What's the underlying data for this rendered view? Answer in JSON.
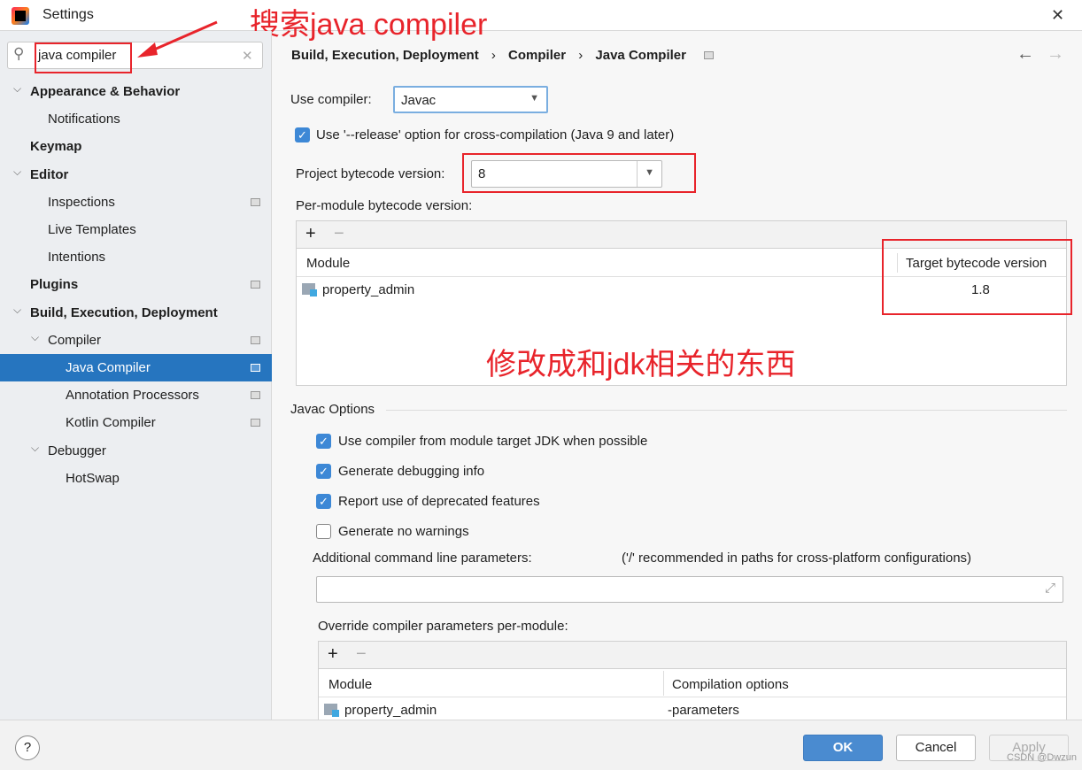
{
  "window": {
    "title": "Settings",
    "close": "✕"
  },
  "annotations": {
    "search_note": "搜索java compiler",
    "modify_note": "修改成和jdk相关的东西",
    "watermark": "CSDN @Dwzun"
  },
  "search": {
    "value": "java compiler",
    "clear": "✕"
  },
  "sidebar": {
    "items": [
      {
        "label": "Appearance & Behavior",
        "level": 0,
        "bold": true,
        "expanded": true
      },
      {
        "label": "Notifications",
        "level": 1
      },
      {
        "label": "Keymap",
        "level": 0,
        "bold": true
      },
      {
        "label": "Editor",
        "level": 0,
        "bold": true,
        "expanded": true
      },
      {
        "label": "Inspections",
        "level": 1,
        "badge": true
      },
      {
        "label": "Live Templates",
        "level": 1
      },
      {
        "label": "Intentions",
        "level": 1
      },
      {
        "label": "Plugins",
        "level": 0,
        "bold": true,
        "badge": true
      },
      {
        "label": "Build, Execution, Deployment",
        "level": 0,
        "bold": true,
        "expanded": true
      },
      {
        "label": "Compiler",
        "level": 1,
        "expanded": true,
        "badge": true
      },
      {
        "label": "Java Compiler",
        "level": 2,
        "selected": true,
        "badge": true
      },
      {
        "label": "Annotation Processors",
        "level": 2,
        "badge": true
      },
      {
        "label": "Kotlin Compiler",
        "level": 2,
        "badge": true
      },
      {
        "label": "Debugger",
        "level": 1,
        "expanded": true
      },
      {
        "label": "HotSwap",
        "level": 2
      }
    ]
  },
  "breadcrumb": [
    "Build, Execution, Deployment",
    "Compiler",
    "Java Compiler"
  ],
  "breadcrumb_sep": "›",
  "nav": {
    "back": "←",
    "forward": "→"
  },
  "main": {
    "use_compiler_label": "Use compiler:",
    "use_compiler_value": "Javac",
    "release_option": {
      "label": "Use '--release' option for cross-compilation (Java 9 and later)",
      "checked": true
    },
    "project_bytecode_label": "Project bytecode version:",
    "project_bytecode_value": "8",
    "per_module_label": "Per-module bytecode version:",
    "per_module_table": {
      "columns": [
        "Module",
        "Target bytecode version"
      ],
      "rows": [
        [
          "property_admin",
          "1.8"
        ]
      ]
    },
    "javac_options_title": "Javac Options",
    "options": [
      {
        "label": "Use compiler from module target JDK when possible",
        "checked": true
      },
      {
        "label": "Generate debugging info",
        "checked": true
      },
      {
        "label": "Report use of deprecated features",
        "checked": true
      },
      {
        "label": "Generate no warnings",
        "checked": false
      }
    ],
    "additional_label": "Additional command line parameters:",
    "additional_hint": "('/' recommended in paths for cross-platform configurations)",
    "additional_value": "",
    "override_label": "Override compiler parameters per-module:",
    "override_table": {
      "columns": [
        "Module",
        "Compilation options"
      ],
      "rows": [
        [
          "property_admin",
          "-parameters"
        ]
      ]
    },
    "add": "+",
    "remove": "−"
  },
  "footer": {
    "help": "?",
    "ok": "OK",
    "cancel": "Cancel",
    "apply": "Apply"
  },
  "colors": {
    "accent": "#2675bf",
    "annotation": "#e8242b",
    "ok_button": "#4a8bd0"
  }
}
